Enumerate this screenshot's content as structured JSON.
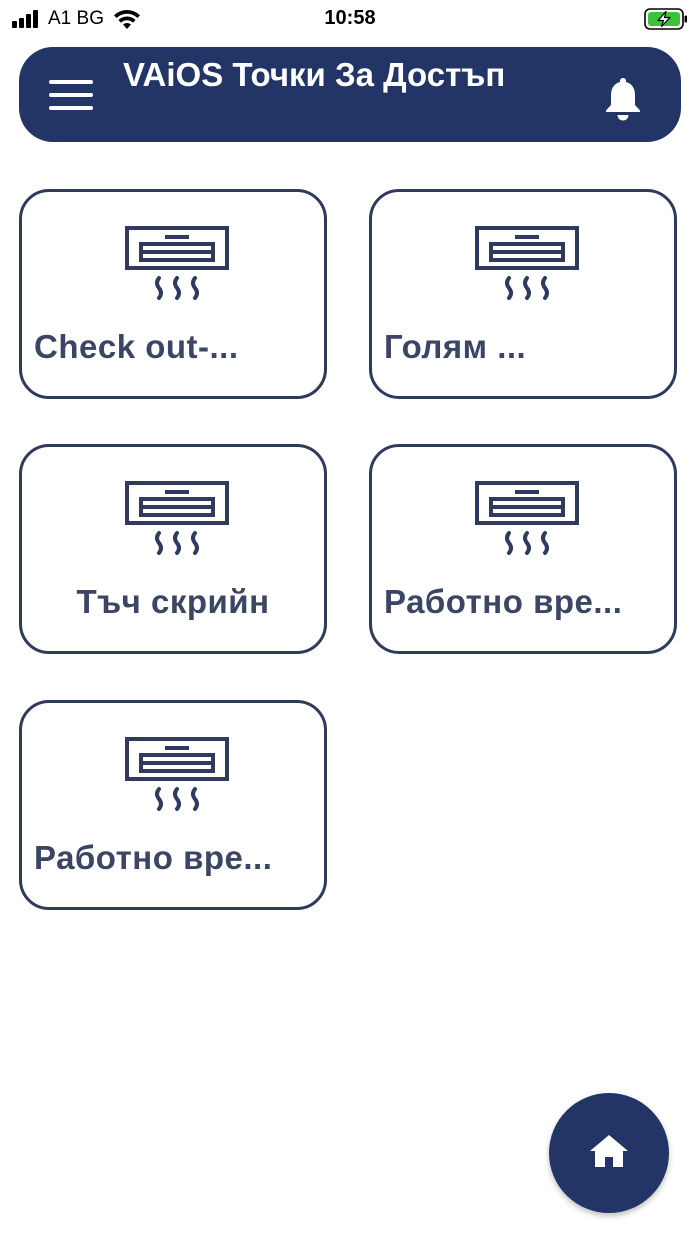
{
  "status_bar": {
    "carrier": "A1 BG",
    "time": "10:58",
    "icons": [
      "signal-icon",
      "wifi-icon",
      "battery-charging-icon"
    ],
    "battery_color": "#3cc13b"
  },
  "app_bar": {
    "title": "VAiOS Точки За Достъп",
    "menu_icon": "hamburger-menu-icon",
    "notification_icon": "bell-icon",
    "background": "#233466"
  },
  "cards": [
    {
      "label": "Check out-...",
      "icon": "air-conditioner-icon"
    },
    {
      "label": "Голям ...",
      "icon": "air-conditioner-icon"
    },
    {
      "label": "Тъч скрийн",
      "icon": "air-conditioner-icon"
    },
    {
      "label": "Работно вре...",
      "icon": "air-conditioner-icon"
    },
    {
      "label": "Работно вре...",
      "icon": "air-conditioner-icon"
    }
  ],
  "fab": {
    "icon": "home-icon"
  },
  "colors": {
    "primary": "#233466",
    "card_border": "#2f3a5c",
    "card_text": "#3a4664"
  }
}
